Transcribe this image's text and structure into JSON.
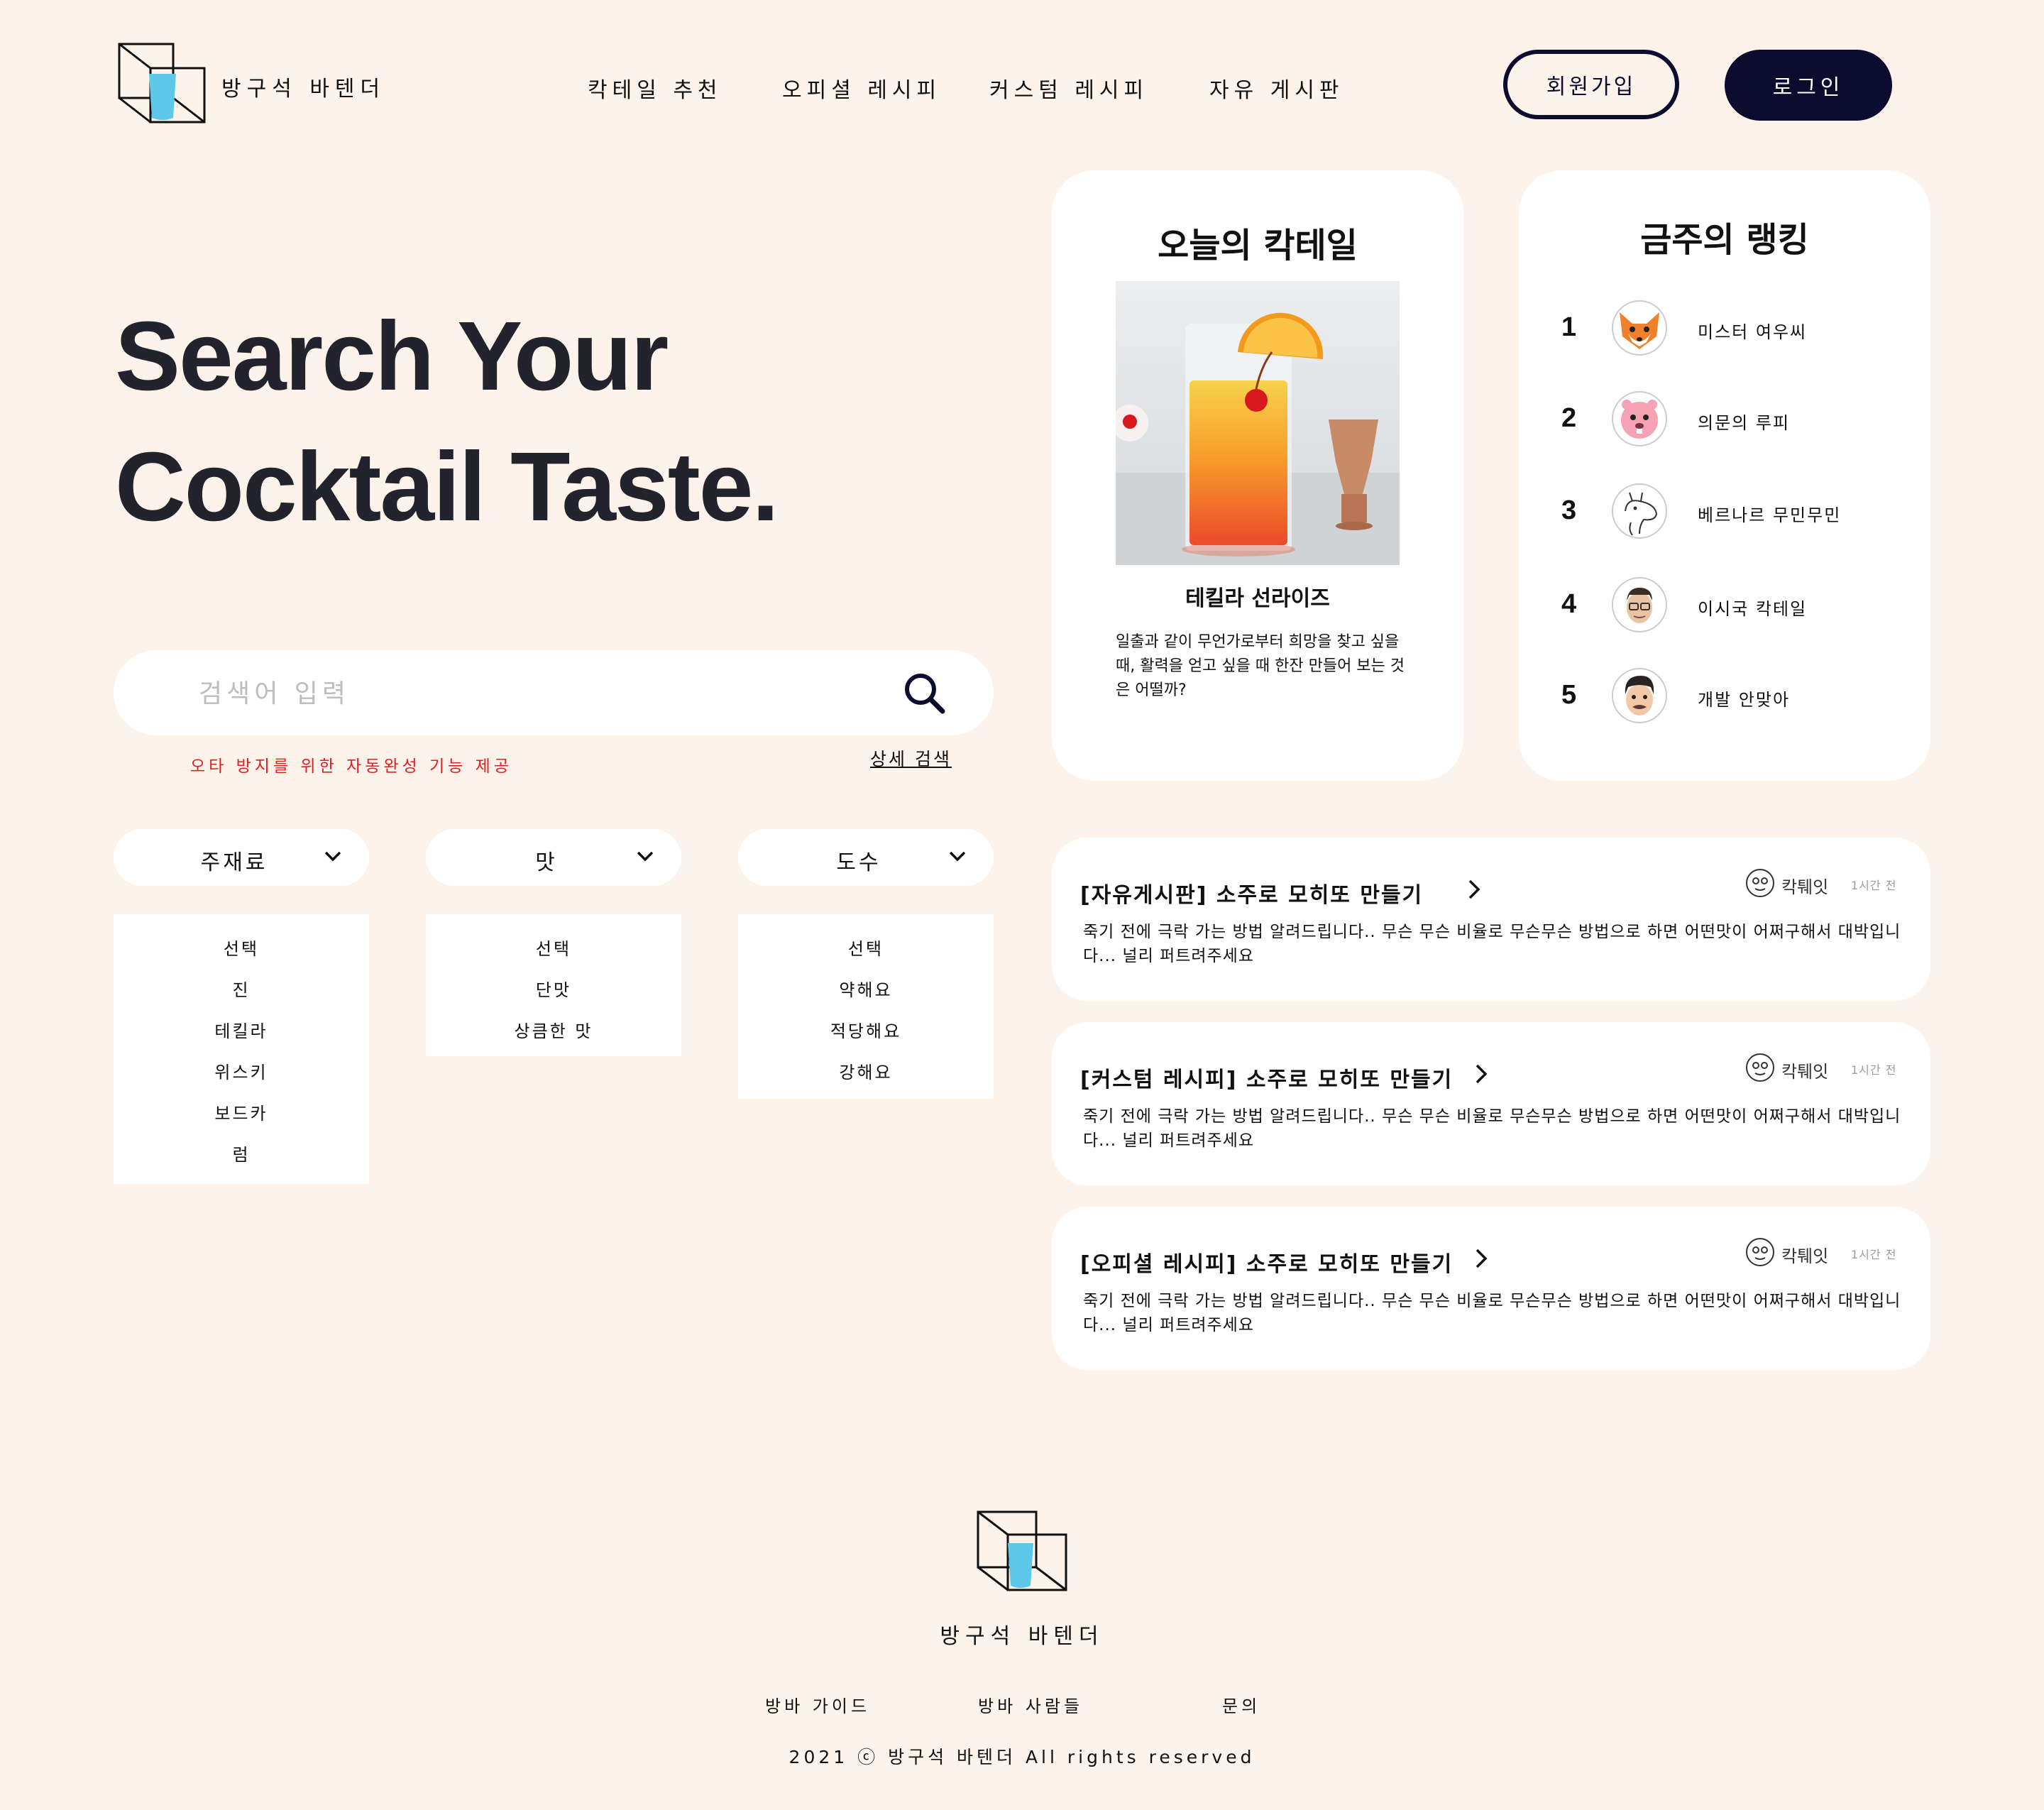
{
  "header": {
    "brand": "방구석 바텐더",
    "nav": [
      "칵테일 추천",
      "오피셜 레시피",
      "커스텀 레시피",
      "자유 게시판"
    ],
    "signup_label": "회원가입",
    "login_label": "로그인"
  },
  "hero": {
    "line1": "Search Your",
    "line2": "Cocktail Taste."
  },
  "search": {
    "placeholder": "검색어 입력",
    "hint": "오타 방지를 위한 자동완성 기능 제공",
    "advanced_label": "상세 검색"
  },
  "filters": [
    {
      "label": "주재료",
      "options": [
        "선택",
        "진",
        "테킬라",
        "위스키",
        "보드카",
        "럼"
      ]
    },
    {
      "label": "맛",
      "options": [
        "선택",
        "단맛",
        "상큼한 맛"
      ]
    },
    {
      "label": "도수",
      "options": [
        "선택",
        "약해요",
        "적당해요",
        "강해요"
      ]
    }
  ],
  "today": {
    "title": "오늘의 칵테일",
    "name": "테킬라 선라이즈",
    "description": "일출과 같이 무언가로부터 희망을 찾고 싶을 때, 활력을 얻고 싶을 때 한잔 만들어 보는 것은 어떨까?"
  },
  "ranking": {
    "title": "금주의 랭킹",
    "items": [
      {
        "rank": "1",
        "name": "미스터 여우씨",
        "avatar": "fox-icon"
      },
      {
        "rank": "2",
        "name": "의문의 루피",
        "avatar": "pink-beaver-icon"
      },
      {
        "rank": "3",
        "name": "베르나르 무민무민",
        "avatar": "moomin-icon"
      },
      {
        "rank": "4",
        "name": "이시국 칵테일",
        "avatar": "man-glasses-icon"
      },
      {
        "rank": "5",
        "name": "개발 안맞아",
        "avatar": "man-memoji-icon"
      }
    ]
  },
  "posts": [
    {
      "title": "[자유게시판] 소주로 모히또 만들기",
      "author": "칵퉤잇",
      "time": "1시간 전",
      "body": "죽기 전에 극락 가는 방법 알려드립니다.. 무슨 무슨 비율로 무슨무슨 방법으로 하면 어떤맛이 어쩌구해서 대박입니다... 널리 퍼트려주세요"
    },
    {
      "title": "[커스텀 레시피] 소주로 모히또 만들기",
      "author": "칵퉤잇",
      "time": "1시간 전",
      "body": "죽기 전에 극락 가는 방법 알려드립니다.. 무슨 무슨 비율로 무슨무슨 방법으로 하면 어떤맛이 어쩌구해서 대박입니다... 널리 퍼트려주세요"
    },
    {
      "title": "[오피셜 레시피] 소주로 모히또 만들기",
      "author": "칵퉤잇",
      "time": "1시간 전",
      "body": "죽기 전에 극락 가는 방법 알려드립니다.. 무슨 무슨 비율로 무슨무슨 방법으로 하면 어떤맛이 어쩌구해서 대박입니다... 널리 퍼트려주세요"
    }
  ],
  "footer": {
    "brand": "방구석 바텐더",
    "links": [
      "방바 가이드",
      "방바 사람들",
      "문의"
    ],
    "copyright": "2021 ⓒ 방구석 바텐더 All rights reserved"
  },
  "colors": {
    "background": "#fdf3ea",
    "navy": "#0b0c2e",
    "accent_glass": "#5ec8ea",
    "hint_red": "#e51d1d"
  }
}
